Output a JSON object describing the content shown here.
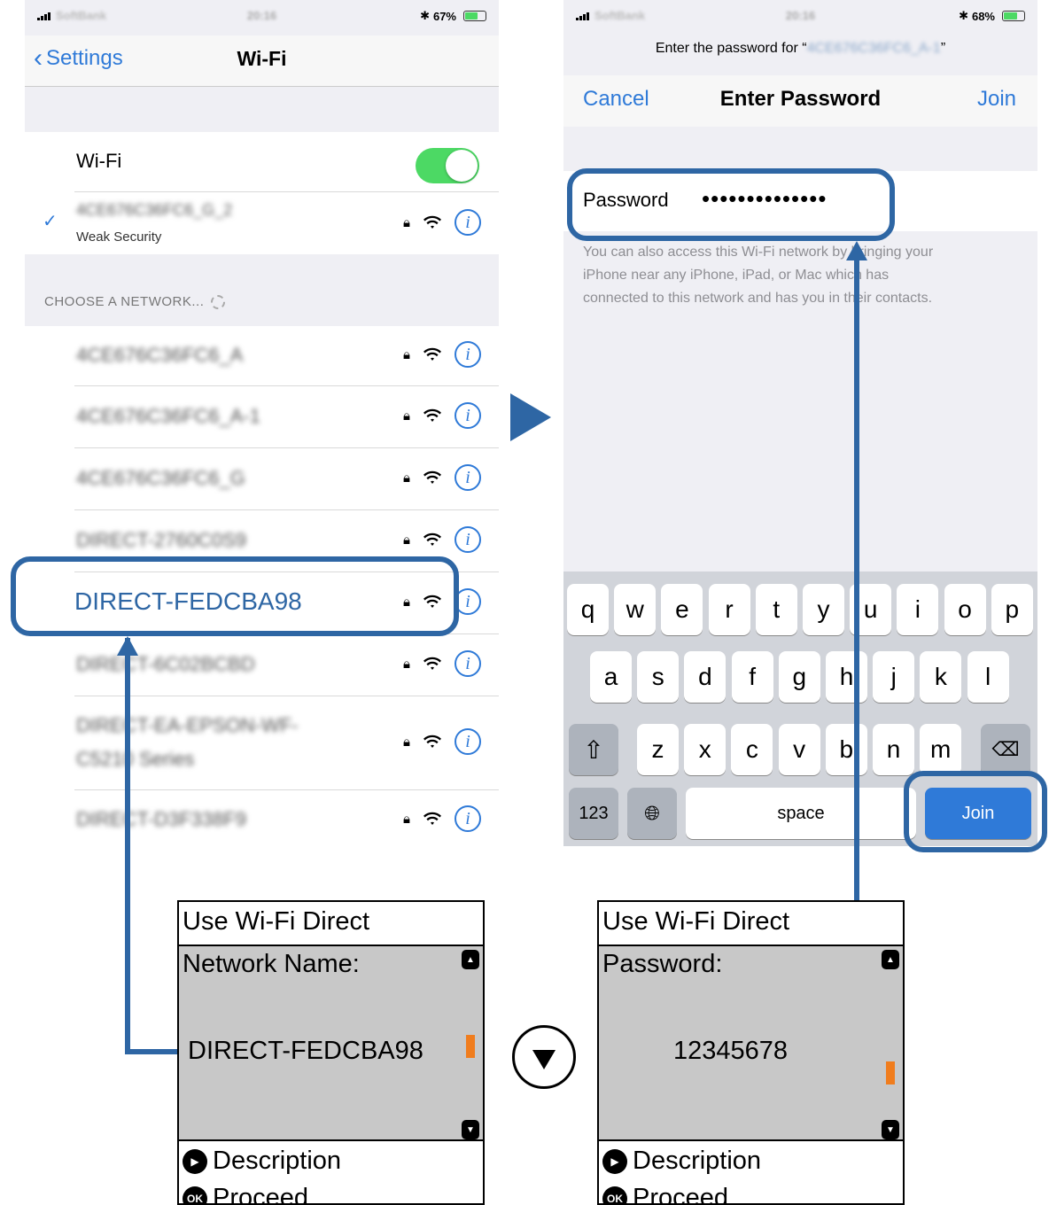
{
  "left_phone": {
    "status": {
      "carrier": "SoftBank",
      "time": "20:16",
      "battery": "67%"
    },
    "nav": {
      "back_label": "Settings",
      "title": "Wi-Fi"
    },
    "wifi_label": "Wi-Fi",
    "connected": {
      "name": "4CE676C36FC6_G_2",
      "subtitle": "Weak Security"
    },
    "section_header": "CHOOSE A NETWORK...",
    "networks": [
      {
        "name": "4CE676C36FC6_A"
      },
      {
        "name": "4CE676C36FC6_A-1"
      },
      {
        "name": "4CE676C36FC6_G"
      },
      {
        "name": "DIRECT-2760C0S9"
      },
      {
        "name": "DIRECT-FEDCBA98"
      },
      {
        "name": "DIRECT-6C02BCBD"
      },
      {
        "name": "DIRECT-EA-EPSON-WF-C5210 Series"
      },
      {
        "name": "DIRECT-D3F338F9"
      }
    ]
  },
  "right_phone": {
    "status": {
      "carrier": "SoftBank",
      "time": "20:16",
      "battery": "68%"
    },
    "prompt_prefix": "Enter the password for “",
    "prompt_network": "4CE676C36FC6_A-1",
    "prompt_suffix": "”",
    "nav": {
      "cancel": "Cancel",
      "title": "Enter Password",
      "join": "Join"
    },
    "password_label": "Password",
    "password_dots": "••••••••••••••",
    "help_line1": "You can also access this Wi-Fi network by bringing your",
    "help_line2": "iPhone near any iPhone, iPad, or Mac which has",
    "help_line3": "connected to this network and has you in their contacts.",
    "keyboard": {
      "row1": [
        "q",
        "w",
        "e",
        "r",
        "t",
        "y",
        "u",
        "i",
        "o",
        "p"
      ],
      "row2": [
        "a",
        "s",
        "d",
        "f",
        "g",
        "h",
        "j",
        "k",
        "l"
      ],
      "row3": [
        "z",
        "x",
        "c",
        "v",
        "b",
        "n",
        "m"
      ],
      "numbers": "123",
      "space": "space",
      "join": "Join"
    }
  },
  "printer_left": {
    "title": "Use Wi-Fi Direct",
    "label": "Network Name:",
    "value": "DIRECT-FEDCBA98",
    "description": "Description",
    "proceed": "Proceed",
    "ok_icon_text": "OK"
  },
  "printer_right": {
    "title": "Use Wi-Fi Direct",
    "label": "Password:",
    "value": "12345678",
    "description": "Description",
    "proceed": "Proceed",
    "ok_icon_text": "OK"
  },
  "colors": {
    "accent": "#2e66a4",
    "ios_blue": "#2f7ad8",
    "toggle_green": "#4cd964",
    "scroll_thumb": "#f07d1e"
  }
}
